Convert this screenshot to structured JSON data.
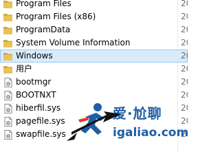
{
  "file_list": {
    "items": [
      {
        "name": "Program Files",
        "type": "folder",
        "date": "20",
        "selected": false
      },
      {
        "name": "Program Files (x86)",
        "type": "folder",
        "date": "20",
        "selected": false
      },
      {
        "name": "ProgramData",
        "type": "folder",
        "date": "20",
        "selected": false
      },
      {
        "name": "System Volume Information",
        "type": "folder",
        "date": "20",
        "selected": false
      },
      {
        "name": "Windows",
        "type": "folder",
        "date": "20",
        "selected": true
      },
      {
        "name": "用户",
        "type": "folder",
        "date": "20",
        "selected": false
      },
      {
        "name": "bootmgr",
        "type": "file",
        "date": "20",
        "selected": false
      },
      {
        "name": "BOOTNXT",
        "type": "file",
        "date": "20",
        "selected": false
      },
      {
        "name": "hiberfil.sys",
        "type": "file",
        "date": "20",
        "selected": false
      },
      {
        "name": "pagefile.sys",
        "type": "file",
        "date": "20",
        "selected": false
      },
      {
        "name": "swapfile.sys",
        "type": "file",
        "date": "20",
        "selected": false
      }
    ]
  },
  "watermark": {
    "brand": "爱·尬聊",
    "url": "igaliao.com",
    "icon": "runner-logo-icon"
  },
  "colors": {
    "folder": "#e8c35a",
    "folder_dark": "#d3a93a",
    "selection_bg": "#d9ebf9",
    "selection_border": "#99c9ef",
    "arrow": "#111111",
    "brand_blue": "#1e5ea6",
    "brand_red": "#e23b2e"
  }
}
